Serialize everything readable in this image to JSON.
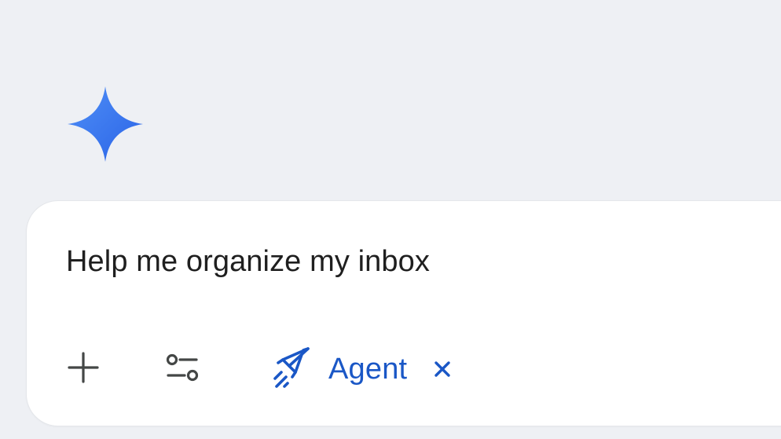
{
  "app": {
    "logo_icon": "gemini-sparkle-icon",
    "accent_color": "#1a57c6",
    "sparkle_color": "#3b78f5"
  },
  "composer": {
    "input_text": "Help me organize my inbox",
    "tools": {
      "add_icon": "plus-icon",
      "settings_icon": "sliders-icon",
      "agent_chip": {
        "icon": "rocket-icon",
        "label": "Agent",
        "close_icon": "close-icon"
      }
    }
  }
}
